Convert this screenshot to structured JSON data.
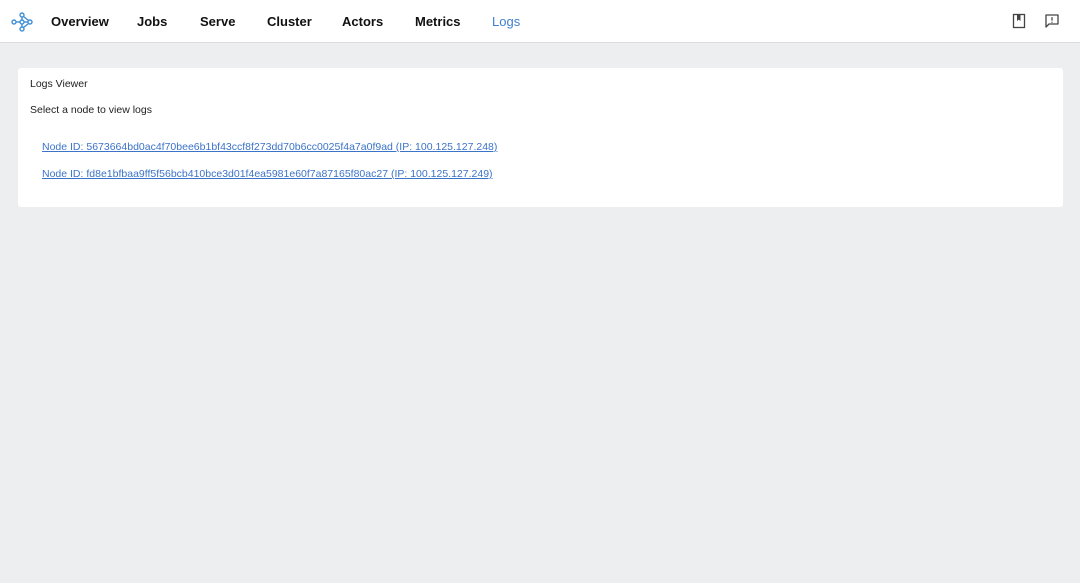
{
  "nav": {
    "logo_icon": "ray-logo-icon",
    "items": [
      {
        "label": "Overview",
        "active": false
      },
      {
        "label": "Jobs",
        "active": false
      },
      {
        "label": "Serve",
        "active": false
      },
      {
        "label": "Cluster",
        "active": false
      },
      {
        "label": "Actors",
        "active": false
      },
      {
        "label": "Metrics",
        "active": false
      },
      {
        "label": "Logs",
        "active": true
      }
    ],
    "right_icons": [
      "docs-book-icon",
      "feedback-icon"
    ]
  },
  "logs_panel": {
    "title": "Logs Viewer",
    "subtitle": "Select a node to view logs",
    "nodes": [
      {
        "label": "Node ID: 5673664bd0ac4f70bee6b1bf43ccf8f273dd70b6cc0025f4a7a0f9ad (IP: 100.125.127.248)"
      },
      {
        "label": "Node ID: fd8e1bfbaa9ff5f56bcb410bce3d01f4ea5981e60f7a87165f80ac27 (IP: 100.125.127.249)"
      }
    ]
  },
  "colors": {
    "accent": "#3f7fd1",
    "link": "#3b73c8",
    "background": "#eceef0"
  }
}
